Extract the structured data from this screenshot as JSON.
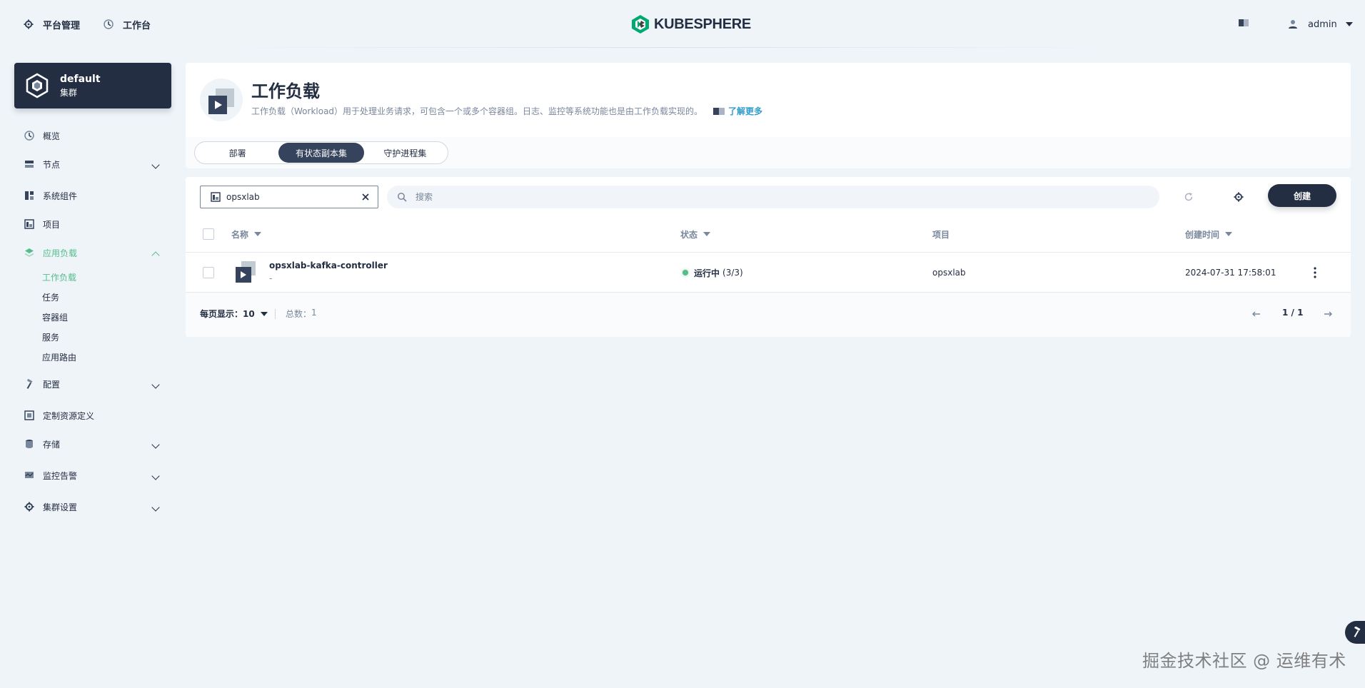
{
  "topbar": {
    "platform_label": "平台管理",
    "workbench_label": "工作台",
    "logo_text": "KUBESPHERE",
    "user_name": "admin"
  },
  "cluster": {
    "name": "default",
    "type": "集群"
  },
  "sidebar": {
    "items": [
      {
        "label": "概览",
        "icon": "dashboard-icon"
      },
      {
        "label": "节点",
        "icon": "nodes-icon"
      },
      {
        "label": "系统组件",
        "icon": "components-icon"
      },
      {
        "label": "项目",
        "icon": "project-icon"
      },
      {
        "label": "应用负载",
        "icon": "appcenter-icon"
      },
      {
        "label": "配置",
        "icon": "hammer-icon"
      },
      {
        "label": "定制资源定义",
        "icon": "crd-icon"
      },
      {
        "label": "存储",
        "icon": "storage-icon"
      },
      {
        "label": "监控告警",
        "icon": "monitor-icon"
      },
      {
        "label": "集群设置",
        "icon": "gear-icon"
      }
    ],
    "sub_items": [
      "工作负载",
      "任务",
      "容器组",
      "服务",
      "应用路由"
    ]
  },
  "banner": {
    "title": "工作负载",
    "description": "工作负载（Workload）用于处理业务请求，可包含一个或多个容器组。日志、监控等系统功能也是由工作负载实现的。",
    "learn_more": "了解更多"
  },
  "tabs": [
    "部署",
    "有状态副本集",
    "守护进程集"
  ],
  "toolbar": {
    "project_value": "opsxlab",
    "search_placeholder": "搜索",
    "create_label": "创建"
  },
  "table": {
    "headers": {
      "name": "名称",
      "status": "状态",
      "project": "项目",
      "created": "创建时间"
    },
    "rows": [
      {
        "name": "opsxlab-kafka-controller",
        "sub": "-",
        "status_label": "运行中",
        "status_count": "(3/3)",
        "project": "opsxlab",
        "created": "2024-07-31 17:58:01"
      }
    ]
  },
  "footer": {
    "per_page_label": "每页显示：",
    "per_page_value": "10",
    "total_label": "总数：",
    "total_value": "1",
    "page_text": "1 / 1"
  },
  "watermark": "掘金技术社区 @ 运维有术",
  "colors": {
    "accent_green": "#55bc8a",
    "dark": "#242e42",
    "link_blue": "#329dce"
  }
}
